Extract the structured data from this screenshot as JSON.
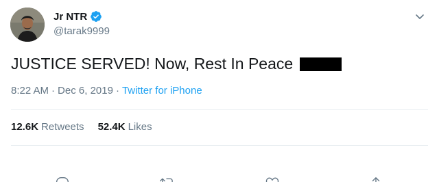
{
  "author": {
    "display_name": "Jr NTR",
    "handle": "@tarak9999",
    "verified": true,
    "avatar_icon": "profile-photo"
  },
  "tweet": {
    "text": "JUSTICE SERVED! Now, Rest In Peace",
    "time": "8:22 AM",
    "separator": "·",
    "date": "Dec 6, 2019",
    "source": "Twitter for iPhone"
  },
  "stats": {
    "retweets_count": "12.6K",
    "retweets_label": "Retweets",
    "likes_count": "52.4K",
    "likes_label": "Likes"
  },
  "actions": {
    "reply_icon": "reply-icon",
    "retweet_icon": "retweet-icon",
    "like_icon": "heart-icon",
    "share_icon": "share-icon"
  },
  "colors": {
    "text_primary": "#14171a",
    "text_secondary": "#657786",
    "accent": "#1da1f2",
    "divider": "#e6ecf0"
  }
}
